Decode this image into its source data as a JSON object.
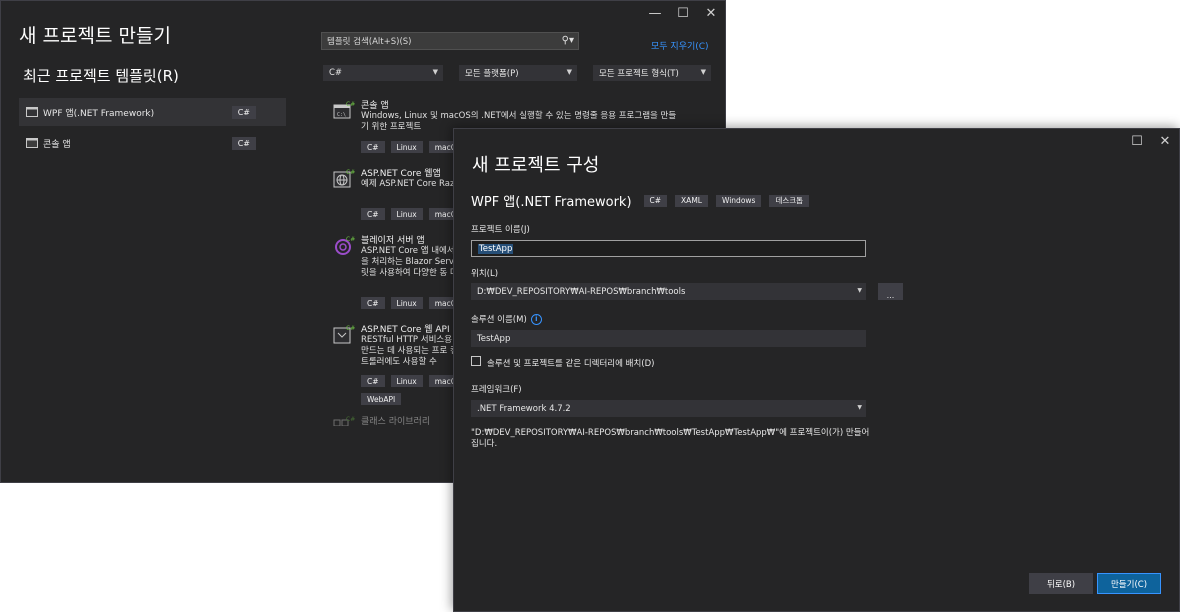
{
  "window1": {
    "title": "새 프로젝트 만들기",
    "recent_templates_title": "최근 프로젝트 템플릿(R)",
    "recent_items": [
      {
        "label": "WPF 앱(.NET Framework)",
        "lang": "C#"
      },
      {
        "label": "콘솔 앱",
        "lang": "C#"
      }
    ],
    "search_placeholder": "템플릿 검색(Alt+S)(S)",
    "clear_all": "모두 지우기(C)",
    "filters": {
      "language": "C#",
      "platform": "모든 플랫폼(P)",
      "project_type": "모든 프로젝트 형식(T)"
    },
    "templates": [
      {
        "name": "콘솔 앱",
        "description": "Windows, Linux 및 macOS의 .NET에서 실행할 수 있는 명령줄 응용 프로그램을 만들기 위한 프로젝트",
        "tags": [
          "C#",
          "Linux",
          "macOS"
        ],
        "icon": "console-icon"
      },
      {
        "name": "ASP.NET Core 웹앱",
        "description": "예제 ASP.NET Core Razor 만들기 위한 프로젝트 템",
        "tags": [
          "C#",
          "Linux",
          "macO"
        ],
        "icon": "globe-icon"
      },
      {
        "name": "블레이저 서버 앱",
        "description": "ASP.NET Core 앱 내에서 을 처리하는 Blazor Serve 릿을 사용하여 다양한 동 다.",
        "tags": [
          "C#",
          "Linux",
          "macO"
        ],
        "icon": "blazor-icon"
      },
      {
        "name": "ASP.NET Core 웹 API",
        "description": "RESTful HTTP 서비스용 만드는 데 사용되는 프로 컨트롤러에도 사용할 수",
        "tags": [
          "C#",
          "Linux",
          "macO",
          "WebAPI"
        ],
        "icon": "webapi-icon"
      },
      {
        "name": "클래스 라이브러리",
        "description": "",
        "tags": [],
        "icon": "library-icon"
      }
    ]
  },
  "window2": {
    "title": "새 프로젝트 구성",
    "project_type": "WPF 앱(.NET Framework)",
    "project_tags": [
      "C#",
      "XAML",
      "Windows",
      "데스크톱"
    ],
    "project_name_label": "프로젝트 이름(J)",
    "project_name_value": "TestApp",
    "location_label": "위치(L)",
    "location_value": "D:₩DEV_REPOSITORY₩AI-REPOS₩branch₩tools",
    "browse_label": "...",
    "solution_name_label": "솔루션 이름(M)",
    "solution_name_value": "TestApp",
    "same_dir_label": "솔루션 및 프로젝트를 같은 디렉터리에 배치(D)",
    "framework_label": "프레임워크(F)",
    "framework_value": ".NET Framework 4.7.2",
    "path_note": "\"D:₩DEV_REPOSITORY₩AI-REPOS₩branch₩tools₩TestApp₩TestApp₩\"에 프로젝트이(가) 만들어집니다.",
    "back_button": "뒤로(B)",
    "create_button": "만들기(C)"
  },
  "colors": {
    "window_bg": "#252526",
    "accent": "#0e639c",
    "link": "#3794ff",
    "badge_bg": "#3f3f46"
  }
}
